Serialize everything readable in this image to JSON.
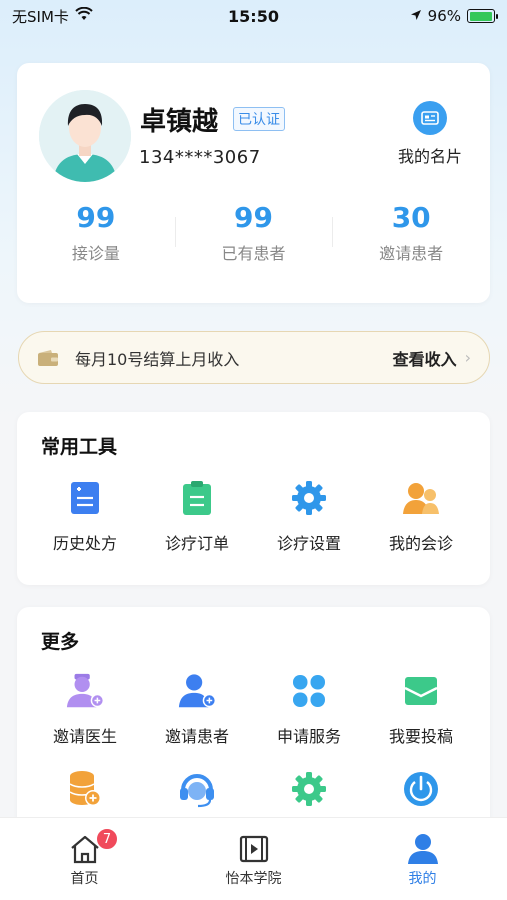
{
  "status_bar": {
    "carrier": "无SIM卡",
    "time": "15:50",
    "battery": "96%",
    "battery_level": 0.96
  },
  "profile": {
    "name": "卓镇越",
    "verified": "已认证",
    "phone": "134****3067",
    "card_label": "我的名片",
    "stats": [
      {
        "value": "99",
        "label": "接诊量"
      },
      {
        "value": "99",
        "label": "已有患者"
      },
      {
        "value": "30",
        "label": "邀请患者"
      }
    ]
  },
  "income_banner": {
    "text": "每月10号结算上月收入",
    "link": "查看收入"
  },
  "tools": {
    "title": "常用工具",
    "items": [
      {
        "label": "历史处方",
        "icon": "prescription-icon",
        "color": "#3d7ff0"
      },
      {
        "label": "诊疗订单",
        "icon": "clipboard-icon",
        "color": "#3cc98a"
      },
      {
        "label": "诊疗设置",
        "icon": "gear-icon",
        "color": "#2f97ea"
      },
      {
        "label": "我的会诊",
        "icon": "consultation-icon",
        "color": "#f2a23a"
      }
    ]
  },
  "more": {
    "title": "更多",
    "items": [
      {
        "label": "邀请医生",
        "icon": "invite-doctor-icon",
        "color": "#b18ff0"
      },
      {
        "label": "邀请患者",
        "icon": "invite-patient-icon",
        "color": "#3d7ff0"
      },
      {
        "label": "申请服务",
        "icon": "clover-icon",
        "color": "#38a6f0"
      },
      {
        "label": "我要投稿",
        "icon": "mail-icon",
        "color": "#3cc98a"
      }
    ],
    "items_row2": [
      {
        "icon": "coin-add-icon",
        "color": "#f2a23a"
      },
      {
        "icon": "headset-icon",
        "color": "#3d8ff0"
      },
      {
        "icon": "settings-green-icon",
        "color": "#3cc98a"
      },
      {
        "icon": "power-icon",
        "color": "#2f97ea"
      }
    ]
  },
  "tab_bar": {
    "tabs": [
      {
        "label": "首页",
        "icon": "home-icon",
        "badge": "7"
      },
      {
        "label": "怡本学院",
        "icon": "video-icon"
      },
      {
        "label": "我的",
        "icon": "user-icon",
        "active": true
      }
    ]
  }
}
